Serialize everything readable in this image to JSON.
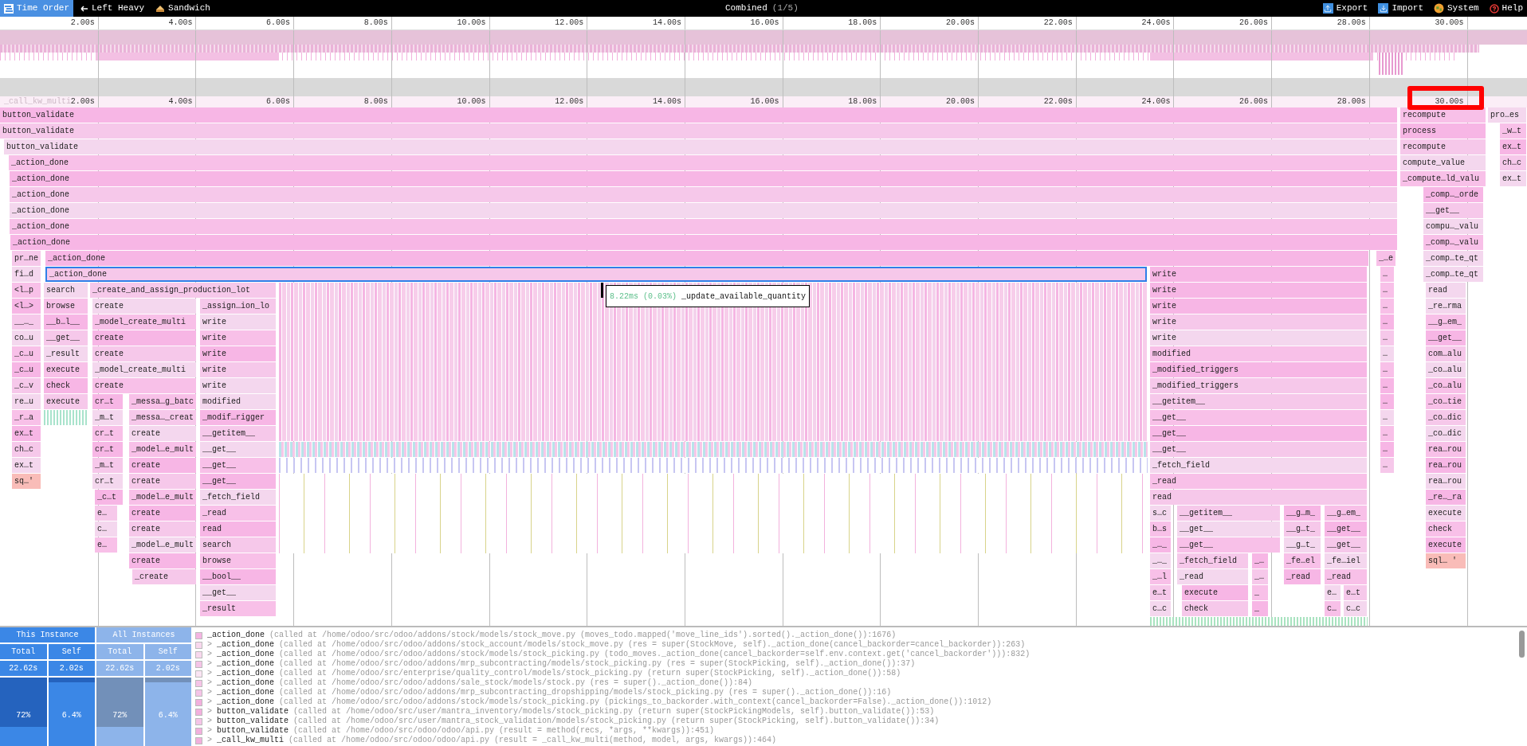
{
  "toolbar": {
    "view_tabs": [
      {
        "label": "Time Order",
        "selected": true
      },
      {
        "label": "Left Heavy",
        "selected": false
      },
      {
        "label": "Sandwich",
        "selected": false
      }
    ],
    "title": "Combined",
    "title_index": "(1/5)",
    "actions": [
      {
        "kind": "export",
        "label": "Export"
      },
      {
        "kind": "import",
        "label": "Import"
      },
      {
        "kind": "system",
        "label": "System"
      },
      {
        "kind": "help",
        "label": "Help"
      }
    ]
  },
  "overview": {
    "ticks": [
      "2.00s",
      "4.00s",
      "6.00s",
      "8.00s",
      "10.00s",
      "12.00s",
      "14.00s",
      "16.00s",
      "18.00s",
      "20.00s",
      "22.00s",
      "24.00s",
      "26.00s",
      "28.00s",
      "30.00s"
    ]
  },
  "flame_chart": {
    "faint_label": "_call_kw_multi",
    "ticks": [
      "2.00s",
      "4.00s",
      "6.00s",
      "8.00s",
      "10.00s",
      "12.00s",
      "14.00s",
      "16.00s",
      "18.00s",
      "20.00s",
      "22.00s",
      "24.00s",
      "26.00s",
      "28.00s",
      "30.00s"
    ],
    "rows": [
      {
        "frames": [
          {
            "label": "button_validate",
            "selected": false
          },
          {
            "label": "recompute",
            "selected": false
          },
          {
            "label": "pro…es",
            "selected": false
          }
        ]
      },
      {
        "frames": [
          {
            "label": "button_validate",
            "selected": false
          },
          {
            "label": "process",
            "selected": false
          },
          {
            "label": "_w…t",
            "selected": false
          }
        ]
      },
      {
        "frames": [
          {
            "label": "button_validate",
            "selected": false
          },
          {
            "label": "recompute",
            "selected": false
          },
          {
            "label": "ex…t",
            "selected": false
          }
        ]
      },
      {
        "frames": [
          {
            "label": "_action_done",
            "selected": false
          },
          {
            "label": "compute_value",
            "selected": false
          },
          {
            "label": "ch…c",
            "selected": false
          }
        ]
      },
      {
        "frames": [
          {
            "label": "_action_done",
            "selected": false
          },
          {
            "label": "_compute…ld_valu",
            "selected": false
          },
          {
            "label": "ex…t",
            "selected": false
          }
        ]
      },
      {
        "frames": [
          {
            "label": "_action_done",
            "selected": false
          },
          {
            "label": "_comp…_orde",
            "selected": false
          }
        ]
      },
      {
        "frames": [
          {
            "label": "_action_done",
            "selected": false
          },
          {
            "label": "__get__",
            "selected": false
          }
        ]
      },
      {
        "frames": [
          {
            "label": "_action_done",
            "selected": false
          },
          {
            "label": "compu…_valu",
            "selected": false
          }
        ]
      },
      {
        "frames": [
          {
            "label": "_action_done",
            "selected": false
          },
          {
            "label": "_comp…_valu",
            "selected": false
          }
        ]
      },
      {
        "frames": [
          {
            "label": "pr…ne",
            "selected": false
          },
          {
            "label": "_action_done",
            "selected": false
          },
          {
            "label": "_…e",
            "selected": false
          },
          {
            "label": "_comp…te_qt",
            "selected": false
          }
        ]
      },
      {
        "frames": [
          {
            "label": "fi…d",
            "selected": false
          },
          {
            "label": "_action_done",
            "selected": true
          },
          {
            "label": "write",
            "selected": false
          },
          {
            "label": "…",
            "selected": false
          },
          {
            "label": "_comp…te_qt",
            "selected": false
          }
        ]
      },
      {
        "frames": [
          {
            "label": "<l…p",
            "selected": false
          },
          {
            "label": "search",
            "selected": false
          },
          {
            "label": "_create_and_assign_production_lot",
            "selected": false
          },
          {
            "label": "write",
            "selected": false
          },
          {
            "label": "…",
            "selected": false
          },
          {
            "label": "read",
            "selected": false
          }
        ]
      },
      {
        "frames": [
          {
            "label": "<l…>",
            "selected": false
          },
          {
            "label": "browse",
            "selected": false
          },
          {
            "label": "create",
            "selected": false
          },
          {
            "label": "_assign…ion_lo",
            "selected": false
          },
          {
            "label": "write",
            "selected": false
          },
          {
            "label": "…",
            "selected": false
          },
          {
            "label": "_re…rma",
            "selected": false
          }
        ]
      },
      {
        "frames": [
          {
            "label": "__…_",
            "selected": false
          },
          {
            "label": "__b…l__",
            "selected": false
          },
          {
            "label": "_model_create_multi",
            "selected": false
          },
          {
            "label": "write",
            "selected": false
          },
          {
            "label": "write",
            "selected": false
          },
          {
            "label": "…",
            "selected": false
          },
          {
            "label": "__g…em_",
            "selected": false
          }
        ]
      },
      {
        "frames": [
          {
            "label": "co…u",
            "selected": false
          },
          {
            "label": "__get__",
            "selected": false
          },
          {
            "label": "create",
            "selected": false
          },
          {
            "label": "write",
            "selected": false
          },
          {
            "label": "write",
            "selected": false
          },
          {
            "label": "…",
            "selected": false
          },
          {
            "label": "__get__",
            "selected": false
          }
        ]
      },
      {
        "frames": [
          {
            "label": "_c…u",
            "selected": false
          },
          {
            "label": "_result",
            "selected": false
          },
          {
            "label": "create",
            "selected": false
          },
          {
            "label": "write",
            "selected": false
          },
          {
            "label": "modified",
            "selected": false
          },
          {
            "label": "…",
            "selected": false
          },
          {
            "label": "com…alu",
            "selected": false
          }
        ]
      },
      {
        "frames": [
          {
            "label": "_c…u",
            "selected": false
          },
          {
            "label": "execute",
            "selected": false
          },
          {
            "label": "_model_create_multi",
            "selected": false
          },
          {
            "label": "write",
            "selected": false
          },
          {
            "label": "_modified_triggers",
            "selected": false
          },
          {
            "label": "…",
            "selected": false
          },
          {
            "label": "_co…alu",
            "selected": false
          }
        ]
      },
      {
        "frames": [
          {
            "label": "_c…v",
            "selected": false
          },
          {
            "label": "check",
            "selected": false
          },
          {
            "label": "create",
            "selected": false
          },
          {
            "label": "write",
            "selected": false
          },
          {
            "label": "_modified_triggers",
            "selected": false
          },
          {
            "label": "…",
            "selected": false
          },
          {
            "label": "_co…alu",
            "selected": false
          }
        ]
      },
      {
        "frames": [
          {
            "label": "re…u",
            "selected": false
          },
          {
            "label": "execute",
            "selected": false
          },
          {
            "label": "cr…t",
            "selected": false
          },
          {
            "label": "_messa…g_batc",
            "selected": false
          },
          {
            "label": "modified",
            "selected": false
          },
          {
            "label": "__getitem__",
            "selected": false
          },
          {
            "label": "…",
            "selected": false
          },
          {
            "label": "_co…tie",
            "selected": false
          }
        ]
      },
      {
        "frames": [
          {
            "label": "_r…a",
            "selected": false
          },
          {
            "label": "_m…t",
            "selected": false
          },
          {
            "label": "_messa…_creat",
            "selected": false
          },
          {
            "label": "_modif…rigger",
            "selected": false
          },
          {
            "label": "__get__",
            "selected": false
          },
          {
            "label": "…",
            "selected": false
          },
          {
            "label": "_co…dic",
            "selected": false
          }
        ]
      },
      {
        "frames": [
          {
            "label": "ex…t",
            "selected": false
          },
          {
            "label": "cr…t",
            "selected": false
          },
          {
            "label": "create",
            "selected": false
          },
          {
            "label": "__getitem__",
            "selected": false
          },
          {
            "label": "__get__",
            "selected": false
          },
          {
            "label": "…",
            "selected": false
          },
          {
            "label": "_co…dic",
            "selected": false
          }
        ]
      },
      {
        "frames": [
          {
            "label": "ch…c",
            "selected": false
          },
          {
            "label": "cr…t",
            "selected": false
          },
          {
            "label": "_model…e_mult",
            "selected": false
          },
          {
            "label": "__get__",
            "selected": false
          },
          {
            "label": "__get__",
            "selected": false
          },
          {
            "label": "…",
            "selected": false
          },
          {
            "label": "rea…rou",
            "selected": false
          }
        ]
      },
      {
        "frames": [
          {
            "label": "ex…t",
            "selected": false
          },
          {
            "label": "_m…t",
            "selected": false
          },
          {
            "label": "create",
            "selected": false
          },
          {
            "label": "__get__",
            "selected": false
          },
          {
            "label": "_fetch_field",
            "selected": false
          },
          {
            "label": "…",
            "selected": false
          },
          {
            "label": "rea…rou",
            "selected": false
          }
        ]
      },
      {
        "frames": [
          {
            "label": "sq…'",
            "selected": false
          },
          {
            "label": "cr…t",
            "selected": false
          },
          {
            "label": "create",
            "selected": false
          },
          {
            "label": "__get__",
            "selected": false
          },
          {
            "label": "_read",
            "selected": false
          },
          {
            "label": "rea…rou",
            "selected": false
          }
        ]
      },
      {
        "frames": [
          {
            "label": "_c…t",
            "selected": false
          },
          {
            "label": "_model…e_mult",
            "selected": false
          },
          {
            "label": "_fetch_field",
            "selected": false
          },
          {
            "label": "read",
            "selected": false
          },
          {
            "label": "_re…_ra",
            "selected": false
          }
        ]
      },
      {
        "frames": [
          {
            "label": "e…",
            "selected": false
          },
          {
            "label": "create",
            "selected": false
          },
          {
            "label": "_read",
            "selected": false
          },
          {
            "label": "s…c",
            "selected": false
          },
          {
            "label": "__getitem__",
            "selected": false
          },
          {
            "label": "__g…m_",
            "selected": false
          },
          {
            "label": "__g…em_",
            "selected": false
          },
          {
            "label": "execute",
            "selected": false
          }
        ]
      },
      {
        "frames": [
          {
            "label": "c…",
            "selected": false
          },
          {
            "label": "create",
            "selected": false
          },
          {
            "label": "read",
            "selected": false
          },
          {
            "label": "b…s",
            "selected": false
          },
          {
            "label": "__get__",
            "selected": false
          },
          {
            "label": "__g…t_",
            "selected": false
          },
          {
            "label": "__get__",
            "selected": false
          },
          {
            "label": "check",
            "selected": false
          }
        ]
      },
      {
        "frames": [
          {
            "label": "e…",
            "selected": false
          },
          {
            "label": "_model…e_mult",
            "selected": false
          },
          {
            "label": "search",
            "selected": false
          },
          {
            "label": "_…_",
            "selected": false
          },
          {
            "label": "__get__",
            "selected": false
          },
          {
            "label": "__g…t_",
            "selected": false
          },
          {
            "label": "__get__",
            "selected": false
          },
          {
            "label": "execute",
            "selected": false
          }
        ]
      },
      {
        "frames": [
          {
            "label": "create",
            "selected": false
          },
          {
            "label": "browse",
            "selected": false
          },
          {
            "label": "_…_",
            "selected": false
          },
          {
            "label": "_fetch_field",
            "selected": false
          },
          {
            "label": "_…",
            "selected": false
          },
          {
            "label": "_fe…el",
            "selected": false
          },
          {
            "label": "_fe…iel",
            "selected": false
          },
          {
            "label": "sql… '",
            "selected": false
          }
        ]
      },
      {
        "frames": [
          {
            "label": "_create",
            "selected": false
          },
          {
            "label": "__bool__",
            "selected": false
          },
          {
            "label": "_…l",
            "selected": false
          },
          {
            "label": "_read",
            "selected": false
          },
          {
            "label": "_…",
            "selected": false
          },
          {
            "label": "_read",
            "selected": false
          },
          {
            "label": "_read",
            "selected": false
          }
        ]
      },
      {
        "frames": [
          {
            "label": "__get__",
            "selected": false
          },
          {
            "label": "e…t",
            "selected": false
          },
          {
            "label": "execute",
            "selected": false
          },
          {
            "label": "_",
            "selected": false
          },
          {
            "label": "e…",
            "selected": false
          },
          {
            "label": "e…t",
            "selected": false
          }
        ]
      },
      {
        "frames": [
          {
            "label": "_result",
            "selected": false
          },
          {
            "label": "c…c",
            "selected": false
          },
          {
            "label": "check",
            "selected": false
          },
          {
            "label": "_",
            "selected": false
          },
          {
            "label": "c…",
            "selected": false
          },
          {
            "label": "c…c",
            "selected": false
          }
        ]
      }
    ],
    "tooltip": {
      "duration": "8.22ms (0.03%)",
      "name": "_update_available_quantity"
    }
  },
  "stats": {
    "groups": [
      {
        "title": "This Instance",
        "columns": [
          {
            "header": "Total",
            "value": "22.62s",
            "percent": "72%",
            "level": 0.72
          },
          {
            "header": "Self",
            "value": "2.02s",
            "percent": "6.4%",
            "level": 0.064
          }
        ]
      },
      {
        "title": "All Instances",
        "columns": [
          {
            "header": "Total",
            "value": "22.62s",
            "percent": "72%",
            "level": 0.72
          },
          {
            "header": "Self",
            "value": "2.02s",
            "percent": "6.4%",
            "level": 0.064
          }
        ]
      }
    ]
  },
  "callers": [
    {
      "name": "_action_done",
      "detail": "(called at /home/odoo/src/odoo/addons/stock/models/stock_move.py (moves_todo.mapped('move_line_ids').sorted()._action_done()):1676)",
      "color": "#f4b4e2"
    },
    {
      "marker": ">",
      "name": "_action_done",
      "detail": "(called at /home/odoo/src/odoo/addons/stock_account/models/stock_move.py (res = super(StockMove, self)._action_done(cancel_backorder=cancel_backorder)):263)",
      "color": "#f8d8ee"
    },
    {
      "marker": ">",
      "name": "_action_done",
      "detail": "(called at /home/odoo/src/odoo/addons/stock/models/stock_picking.py (todo_moves._action_done(cancel_backorder=self.env.context.get('cancel_backorder'))):832)",
      "color": "#f8d8ee"
    },
    {
      "marker": ">",
      "name": "_action_done",
      "detail": "(called at /home/odoo/src/odoo/addons/mrp_subcontracting/models/stock_picking.py (res = super(StockPicking, self)._action_done()):37)",
      "color": "#f5c4e7"
    },
    {
      "marker": ">",
      "name": "_action_done",
      "detail": "(called at /home/odoo/src/enterprise/quality_control/models/stock_picking.py (return super(StockPicking, self)._action_done()):58)",
      "color": "#fae4f3"
    },
    {
      "marker": ">",
      "name": "_action_done",
      "detail": "(called at /home/odoo/src/odoo/addons/sale_stock/models/stock.py (res = super()._action_done()):84)",
      "color": "#f5c4e7"
    },
    {
      "marker": ">",
      "name": "_action_done",
      "detail": "(called at /home/odoo/src/odoo/addons/mrp_subcontracting_dropshipping/models/stock_picking.py (res = super()._action_done()):16)",
      "color": "#f5c4e7"
    },
    {
      "marker": ">",
      "name": "_action_done",
      "detail": "(called at /home/odoo/src/odoo/addons/stock/models/stock_picking.py (pickings_to_backorder.with_context(cancel_backorder=False)._action_done()):1012)",
      "color": "#f2b0dd"
    },
    {
      "marker": ">",
      "name": "button_validate",
      "detail": "(called at /home/odoo/src/user/mantra_inventory/models/stock_picking.py (return super(StockPickingModels, self).button_validate()):53)",
      "color": "#f2b0dd"
    },
    {
      "marker": ">",
      "name": "button_validate",
      "detail": "(called at /home/odoo/src/user/mantra_stock_validation/models/stock_picking.py (return super(StockPicking, self).button_validate()):34)",
      "color": "#f5c4e7"
    },
    {
      "marker": ">",
      "name": "button_validate",
      "detail": "(called at /home/odoo/src/odoo/odoo/api.py (result = method(recs, *args, **kwargs)):451)",
      "color": "#f2b0dd"
    },
    {
      "marker": ">",
      "name": "_call_kw_multi",
      "detail": "(called at /home/odoo/src/odoo/odoo/api.py (result = _call_kw_multi(method, model, args, kwargs)):464)",
      "color": "#f2b0dd"
    }
  ]
}
